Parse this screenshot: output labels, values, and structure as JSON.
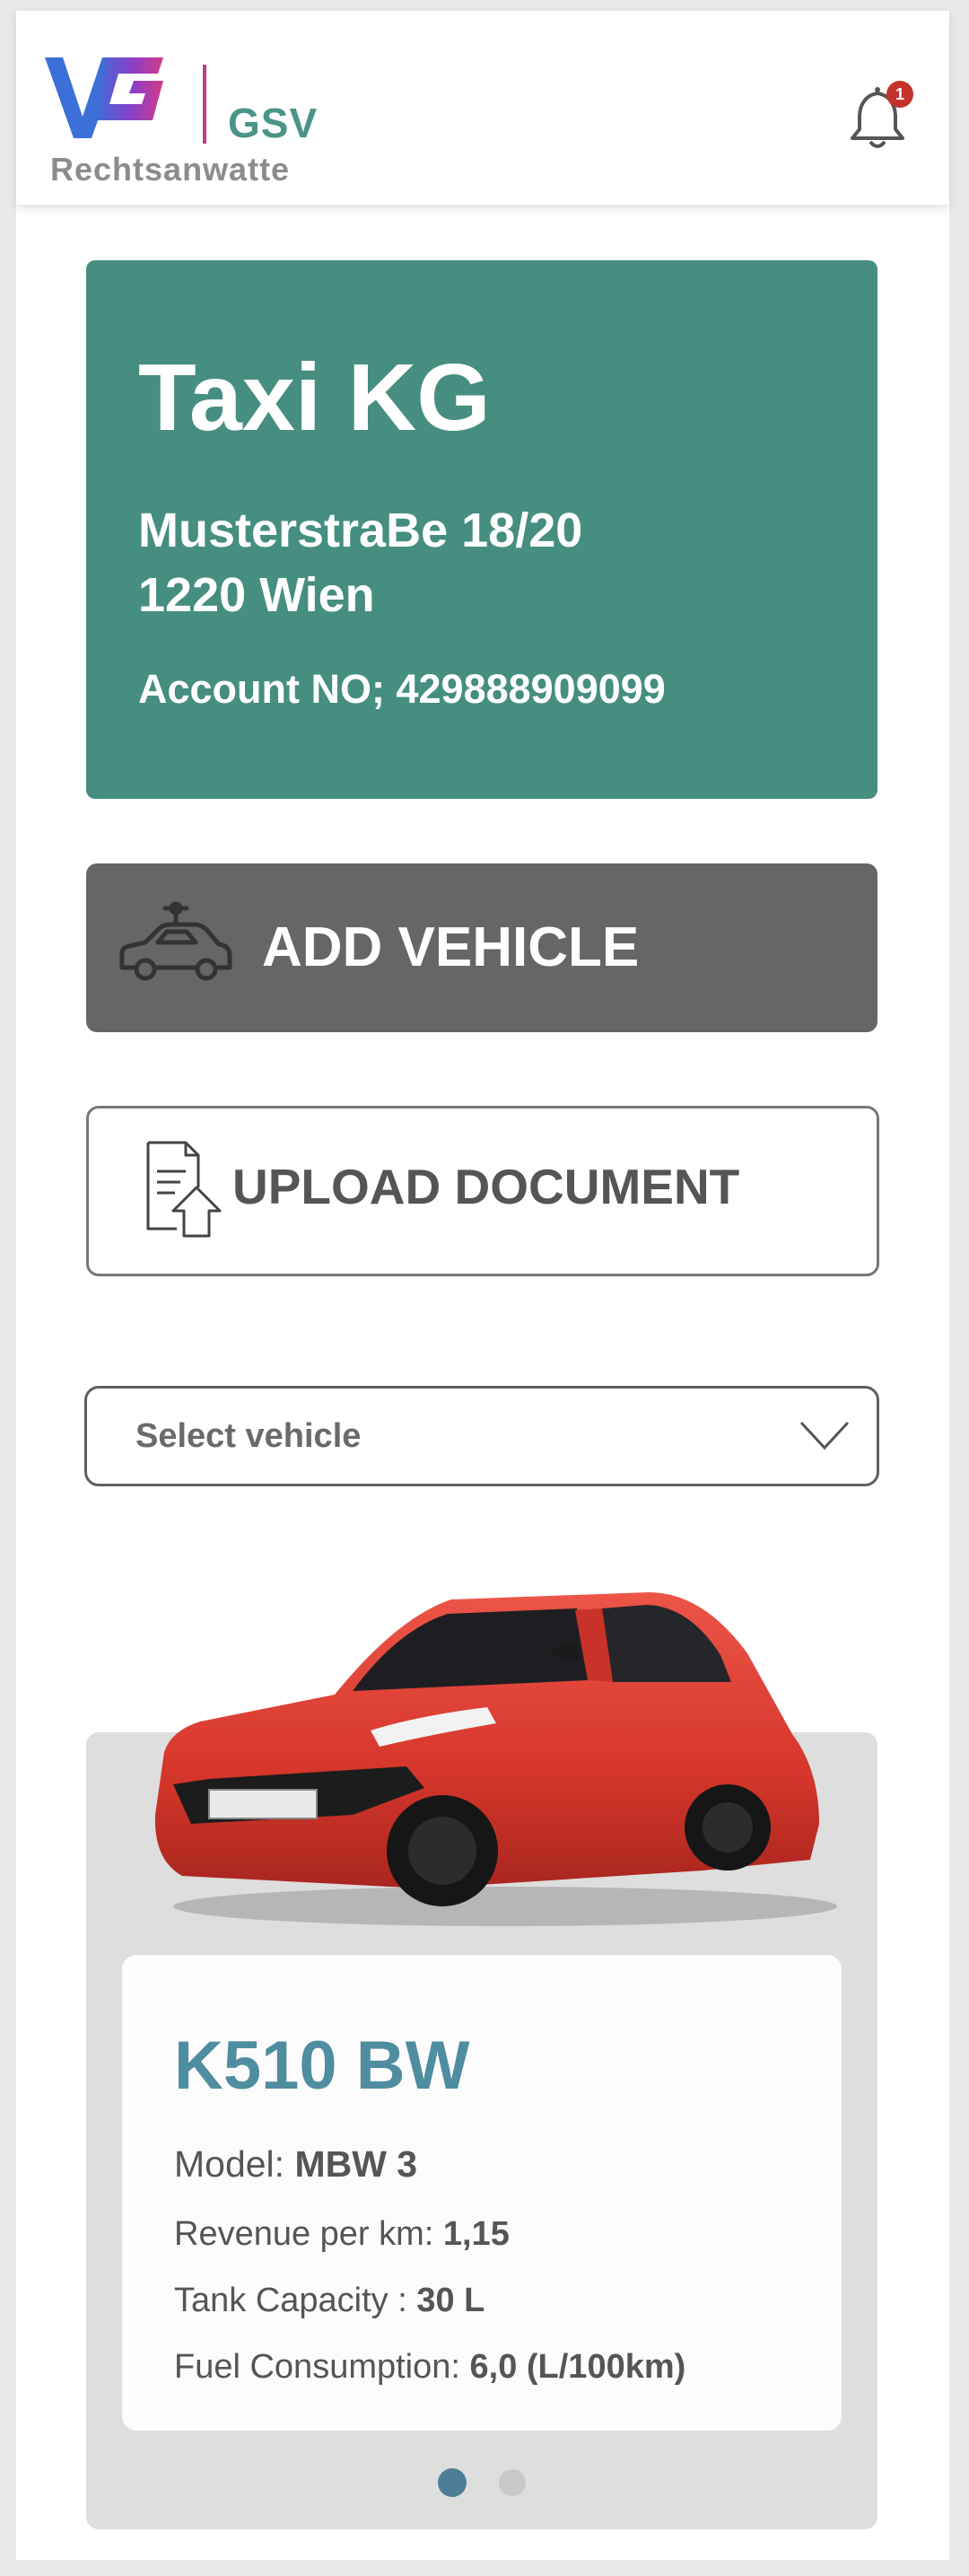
{
  "header": {
    "brand_short": "GSV",
    "brand_sub": "Rechtsanwatte",
    "notification_count": "1",
    "logo_colors": [
      "#3c6fd8",
      "#8a3fc7",
      "#d43a8a"
    ]
  },
  "account": {
    "company": "Taxi KG",
    "street": "MusterstraBe 18/20",
    "city": "1220 Wien",
    "account_no": "Account NO; 429888909099",
    "color": "#458e80"
  },
  "actions": {
    "add_vehicle": "ADD VEHICLE",
    "upload_document": "UPLOAD DOCUMENT"
  },
  "vehicle_select": {
    "placeholder": "Select vehicle"
  },
  "vehicle": {
    "plate": "K510 BW",
    "model_label": "Model:",
    "model_value": "MBW 3",
    "revenue_label": "Revenue per km:",
    "revenue_value": "1,15",
    "tank_label": "Tank Capacity :",
    "tank_value": "30 L",
    "fuel_label": "Fuel Consumption:",
    "fuel_value": "6,0 (L/100km)",
    "image": "red-hatchback-car"
  },
  "carousel": {
    "total_pages": 2,
    "active_page": 1
  }
}
